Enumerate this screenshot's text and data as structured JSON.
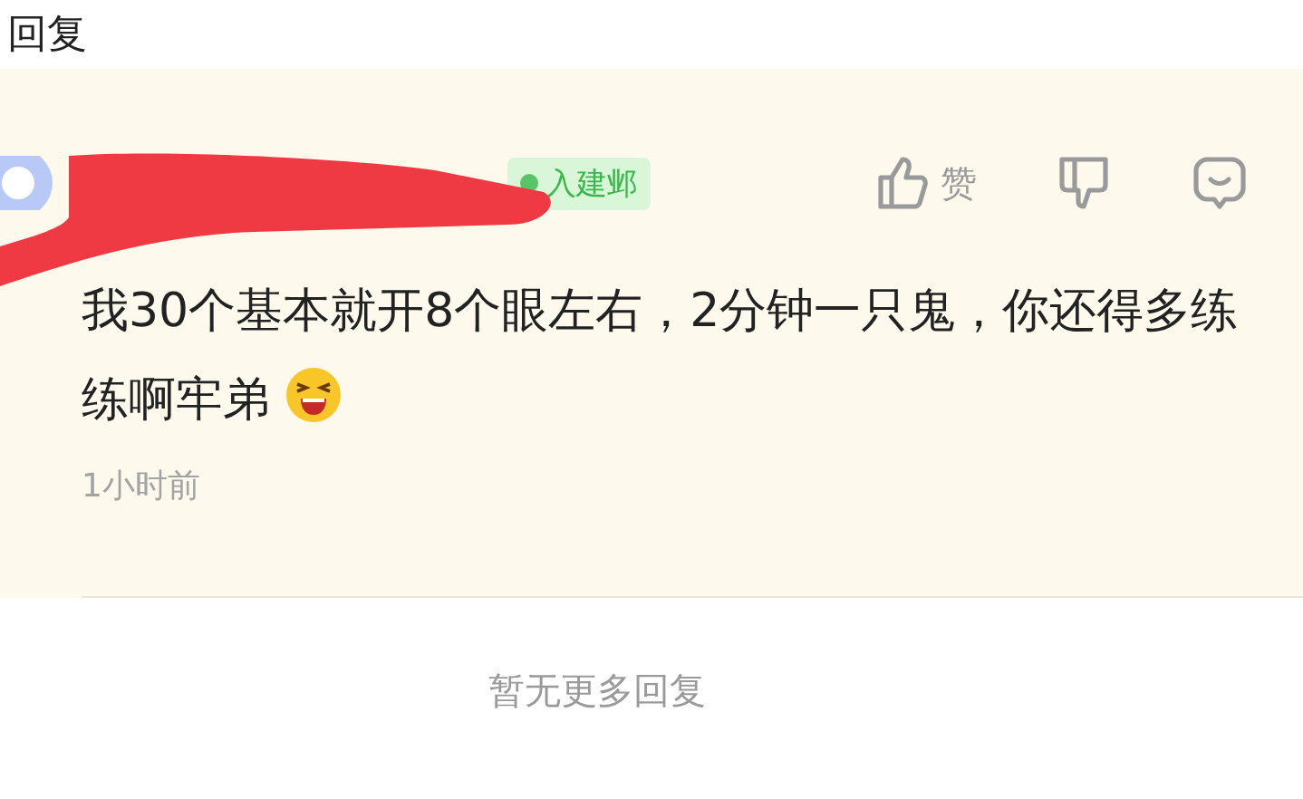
{
  "header": {
    "title": "回复"
  },
  "comment": {
    "badge": "入建邺",
    "like_label": "赞",
    "text": "我30个基本就开8个眼左右，2分钟一只鬼，你还得多练练啊牢弟",
    "time": "1小时前"
  },
  "footer": {
    "message": "暂无更多回复"
  }
}
